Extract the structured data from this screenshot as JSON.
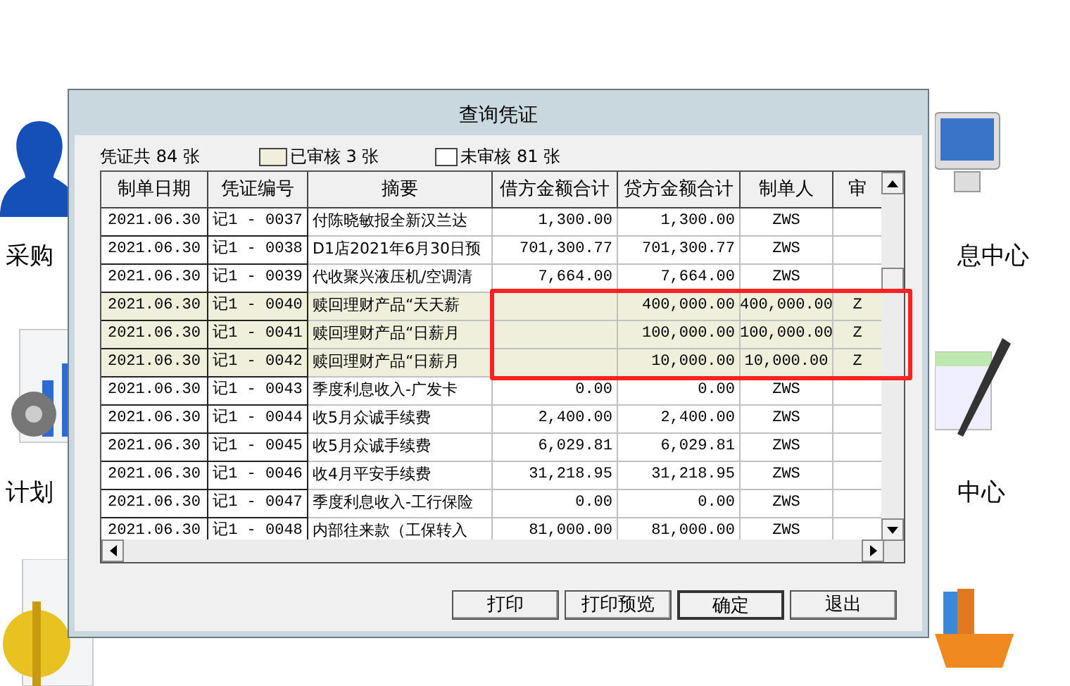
{
  "desktop_icons": [
    {
      "label": "采购",
      "kind": "person"
    },
    {
      "label": "计划",
      "kind": "chart"
    },
    {
      "kind": "money"
    },
    {
      "label": "息中心",
      "kind": "monitor"
    },
    {
      "label": "中心",
      "kind": "pen"
    },
    {
      "kind": "books"
    }
  ],
  "window": {
    "title": "查询凭证"
  },
  "summary": {
    "total": "凭证共 84 张",
    "audited": "已审核 3 张",
    "unaudited": "未审核 81 张"
  },
  "table": {
    "columns": [
      "制单日期",
      "凭证编号",
      "摘要",
      "借方金额合计",
      "贷方金额合计",
      "制单人",
      "审"
    ],
    "rows": [
      {
        "audited": false,
        "cells": [
          "2021.06.30",
          "记1 - 0037",
          "付陈晓敏报全新汉兰达",
          "1,300.00",
          "1,300.00",
          "ZWS",
          ""
        ]
      },
      {
        "audited": false,
        "cells": [
          "2021.06.30",
          "记1 - 0038",
          "D1店2021年6月30日预",
          "701,300.77",
          "701,300.77",
          "ZWS",
          ""
        ]
      },
      {
        "audited": false,
        "cells": [
          "2021.06.30",
          "记1 - 0039",
          "代收聚兴液压机/空调清",
          "7,664.00",
          "7,664.00",
          "ZWS",
          ""
        ]
      },
      {
        "audited": true,
        "cells": [
          "2021.06.30",
          "记1 - 0040",
          "赎回理财产品“天天薪",
          "",
          "400,000.00",
          "400,000.00",
          "Z"
        ]
      },
      {
        "audited": true,
        "cells": [
          "2021.06.30",
          "记1 - 0041",
          "赎回理财产品“日薪月",
          "",
          "100,000.00",
          "100,000.00",
          "Z"
        ]
      },
      {
        "audited": true,
        "cells": [
          "2021.06.30",
          "记1 - 0042",
          "赎回理财产品“日薪月",
          "",
          "10,000.00",
          "10,000.00",
          "Z"
        ]
      },
      {
        "audited": false,
        "cells": [
          "2021.06.30",
          "记1 - 0043",
          "季度利息收入-广发卡",
          "0.00",
          "0.00",
          "ZWS",
          ""
        ]
      },
      {
        "audited": false,
        "cells": [
          "2021.06.30",
          "记1 - 0044",
          "收5月众诚手续费",
          "2,400.00",
          "2,400.00",
          "ZWS",
          ""
        ]
      },
      {
        "audited": false,
        "cells": [
          "2021.06.30",
          "记1 - 0045",
          "收5月众诚手续费",
          "6,029.81",
          "6,029.81",
          "ZWS",
          ""
        ]
      },
      {
        "audited": false,
        "cells": [
          "2021.06.30",
          "记1 - 0046",
          "收4月平安手续费",
          "31,218.95",
          "31,218.95",
          "ZWS",
          ""
        ]
      },
      {
        "audited": false,
        "cells": [
          "2021.06.30",
          "记1 - 0047",
          "季度利息收入-工行保险",
          "0.00",
          "0.00",
          "ZWS",
          ""
        ]
      },
      {
        "audited": false,
        "cells": [
          "2021.06.30",
          "记1 - 0048",
          "内部往来款（工保转入",
          "81,000.00",
          "81,000.00",
          "ZWS",
          ""
        ]
      }
    ]
  },
  "buttons": [
    {
      "label": "打印",
      "selected": false
    },
    {
      "label": "打印预览",
      "selected": false
    },
    {
      "label": "确定",
      "selected": true
    },
    {
      "label": "退出",
      "selected": false
    }
  ]
}
